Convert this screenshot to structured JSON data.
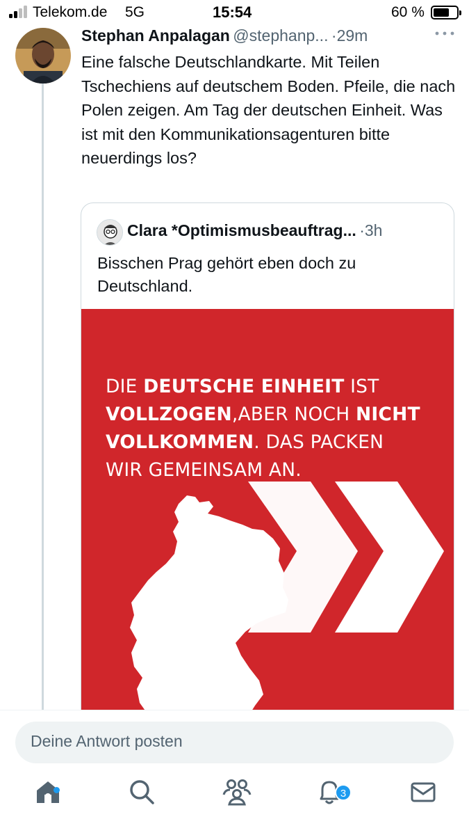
{
  "status_bar": {
    "carrier": "Telekom.de",
    "network": "5G",
    "time": "15:54",
    "battery_percent": "60 %",
    "battery_level": 0.6
  },
  "tweet": {
    "author_name": "Stephan Anpalagan",
    "author_handle": "@stephanp...",
    "separator": "·",
    "time": "29m",
    "text": "Eine falsche Deutschlandkarte. Mit Teilen Tschechiens auf deutschem Boden. Pfeile, die nach Polen zeigen. Am Tag der deutschen Einheit. Was ist mit den Kommunikationsagenturen bitte neuerdings los?",
    "more_icon": "more-horizontal-icon"
  },
  "quote": {
    "author_name": "Clara *Optimismusbeauftrag...",
    "separator": "·",
    "time": "3h",
    "text": "Bisschen Prag gehört eben doch zu Deutschland.",
    "image": {
      "headline": {
        "l1a": "DIE ",
        "l1b": "DEUTSCHE EINHEIT",
        "l1c": " IST",
        "l2a": "VOLLZOGEN",
        "l2b": ",ABER NOCH ",
        "l2c": "NICHT",
        "l3a": "VOLLKOMMEN",
        "l3b": ". DAS PACKEN",
        "l4": "WIR GEMEINSAM AN."
      },
      "background_color": "#d0262b"
    }
  },
  "reply": {
    "placeholder": "Deine Antwort posten"
  },
  "tab_bar": {
    "items": [
      {
        "name": "home",
        "icon": "home-icon"
      },
      {
        "name": "search",
        "icon": "search-icon"
      },
      {
        "name": "communities",
        "icon": "communities-icon"
      },
      {
        "name": "notifications",
        "icon": "bell-icon",
        "badge": "3"
      },
      {
        "name": "messages",
        "icon": "mail-icon"
      }
    ],
    "notification_badge": "3"
  },
  "colors": {
    "accent": "#1d9bf0",
    "text_primary": "#0f1419",
    "text_secondary": "#536471",
    "border": "#cfd9de"
  }
}
